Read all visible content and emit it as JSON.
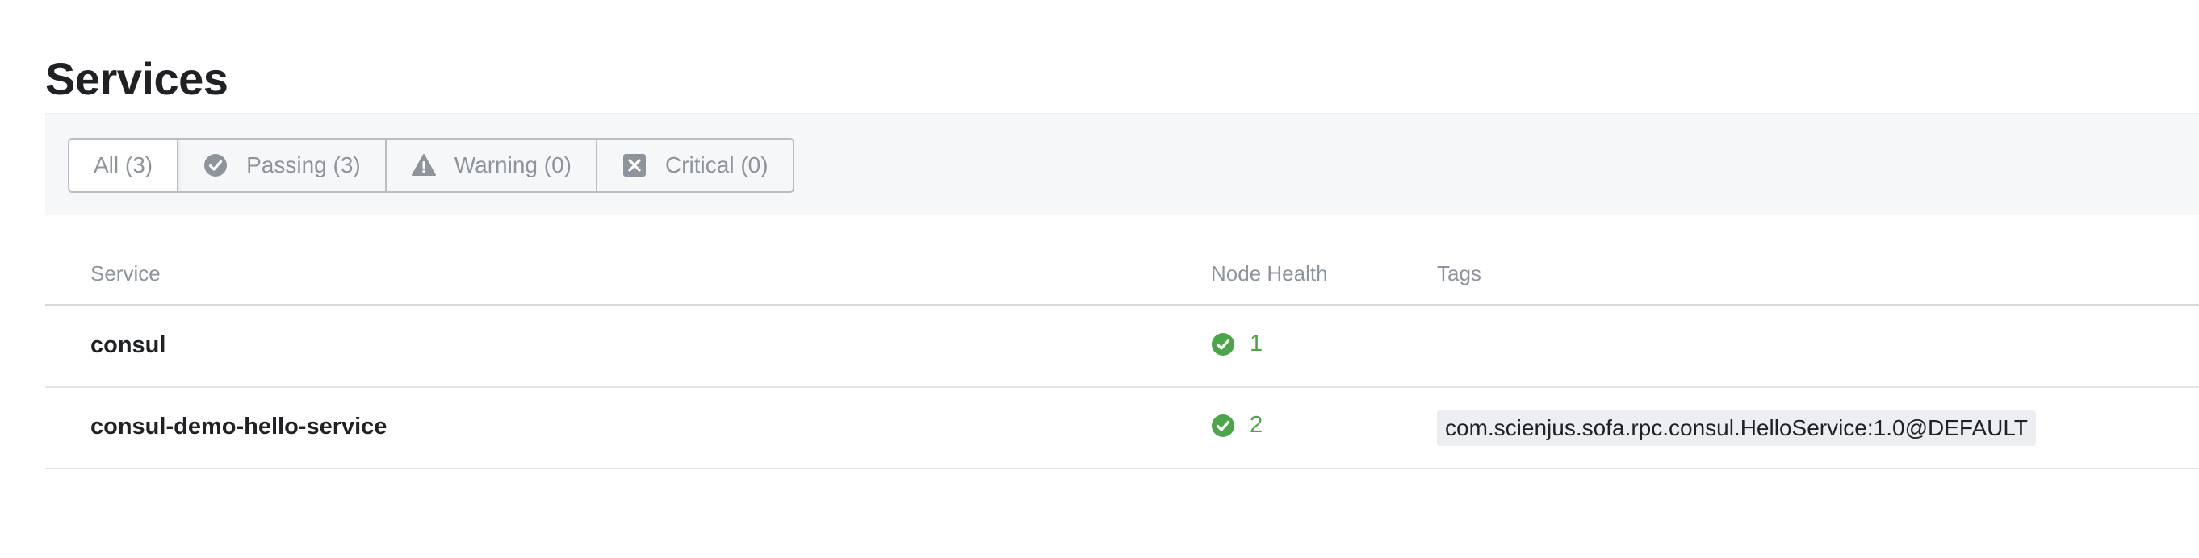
{
  "page": {
    "title": "Services"
  },
  "filters": [
    {
      "label": "All (3)",
      "icon": "",
      "active": true
    },
    {
      "label": "Passing (3)",
      "icon": "check-circle-icon",
      "active": false
    },
    {
      "label": "Warning (0)",
      "icon": "warning-triangle-icon",
      "active": false
    },
    {
      "label": "Critical (0)",
      "icon": "critical-x-icon",
      "active": false
    }
  ],
  "table": {
    "headers": {
      "service": "Service",
      "node_health": "Node Health",
      "tags": "Tags"
    },
    "rows": [
      {
        "service": "consul",
        "health": "1",
        "tags": []
      },
      {
        "service": "consul-demo-hello-service",
        "health": "2",
        "tags": [
          "com.scienjus.sofa.rpc.consul.HelloService:1.0@DEFAULT"
        ]
      }
    ]
  },
  "colors": {
    "passing": "#4ca54a",
    "muted": "#8e949c",
    "filter_bg": "#f6f7f9"
  }
}
